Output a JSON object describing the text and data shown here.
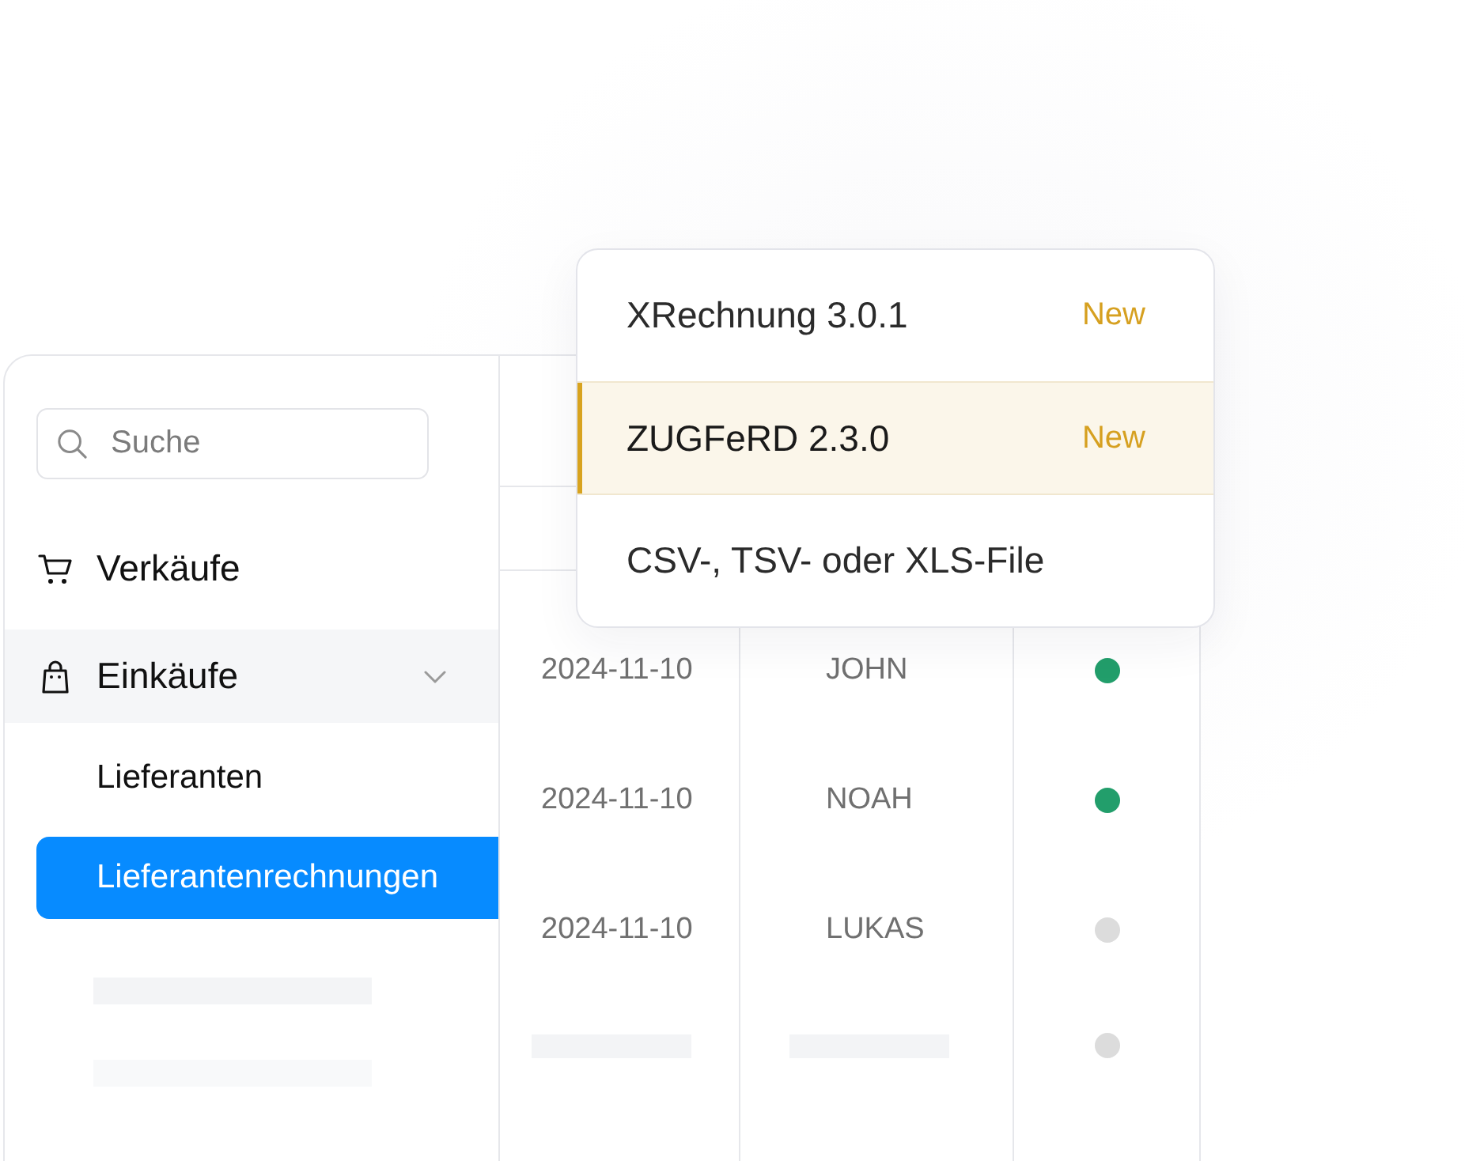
{
  "sidebar": {
    "search": {
      "placeholder": "Suche"
    },
    "items": [
      {
        "label": "Verkäufe"
      },
      {
        "label": "Einkäufe",
        "expanded": true,
        "children": [
          {
            "kind": "link",
            "label": "Lieferanten",
            "selected": false
          },
          {
            "kind": "link",
            "label": "Lieferantenrechnungen",
            "selected": true
          },
          {
            "kind": "skeleton"
          },
          {
            "kind": "skeleton"
          }
        ]
      }
    ]
  },
  "table": {
    "rows": [
      {
        "kind": "data",
        "date": "2024-11-10",
        "name": "JOHN",
        "color": "#229e6b"
      },
      {
        "kind": "data",
        "date": "2024-11-10",
        "name": "NOAH",
        "color": "#229e6b"
      },
      {
        "kind": "data",
        "date": "2024-11-10",
        "name": "LUKAS",
        "color": "#dcdcdc"
      },
      {
        "kind": "skeleton",
        "color": "#dcdcdc"
      }
    ]
  },
  "menu": {
    "items": [
      {
        "label": "XRechnung 3.0.1",
        "badge": "New",
        "selected": false
      },
      {
        "label": "ZUGFeRD 2.3.0",
        "badge": "New",
        "selected": true
      },
      {
        "label": "CSV-, TSV- oder XLS-File",
        "selected": false
      }
    ]
  }
}
